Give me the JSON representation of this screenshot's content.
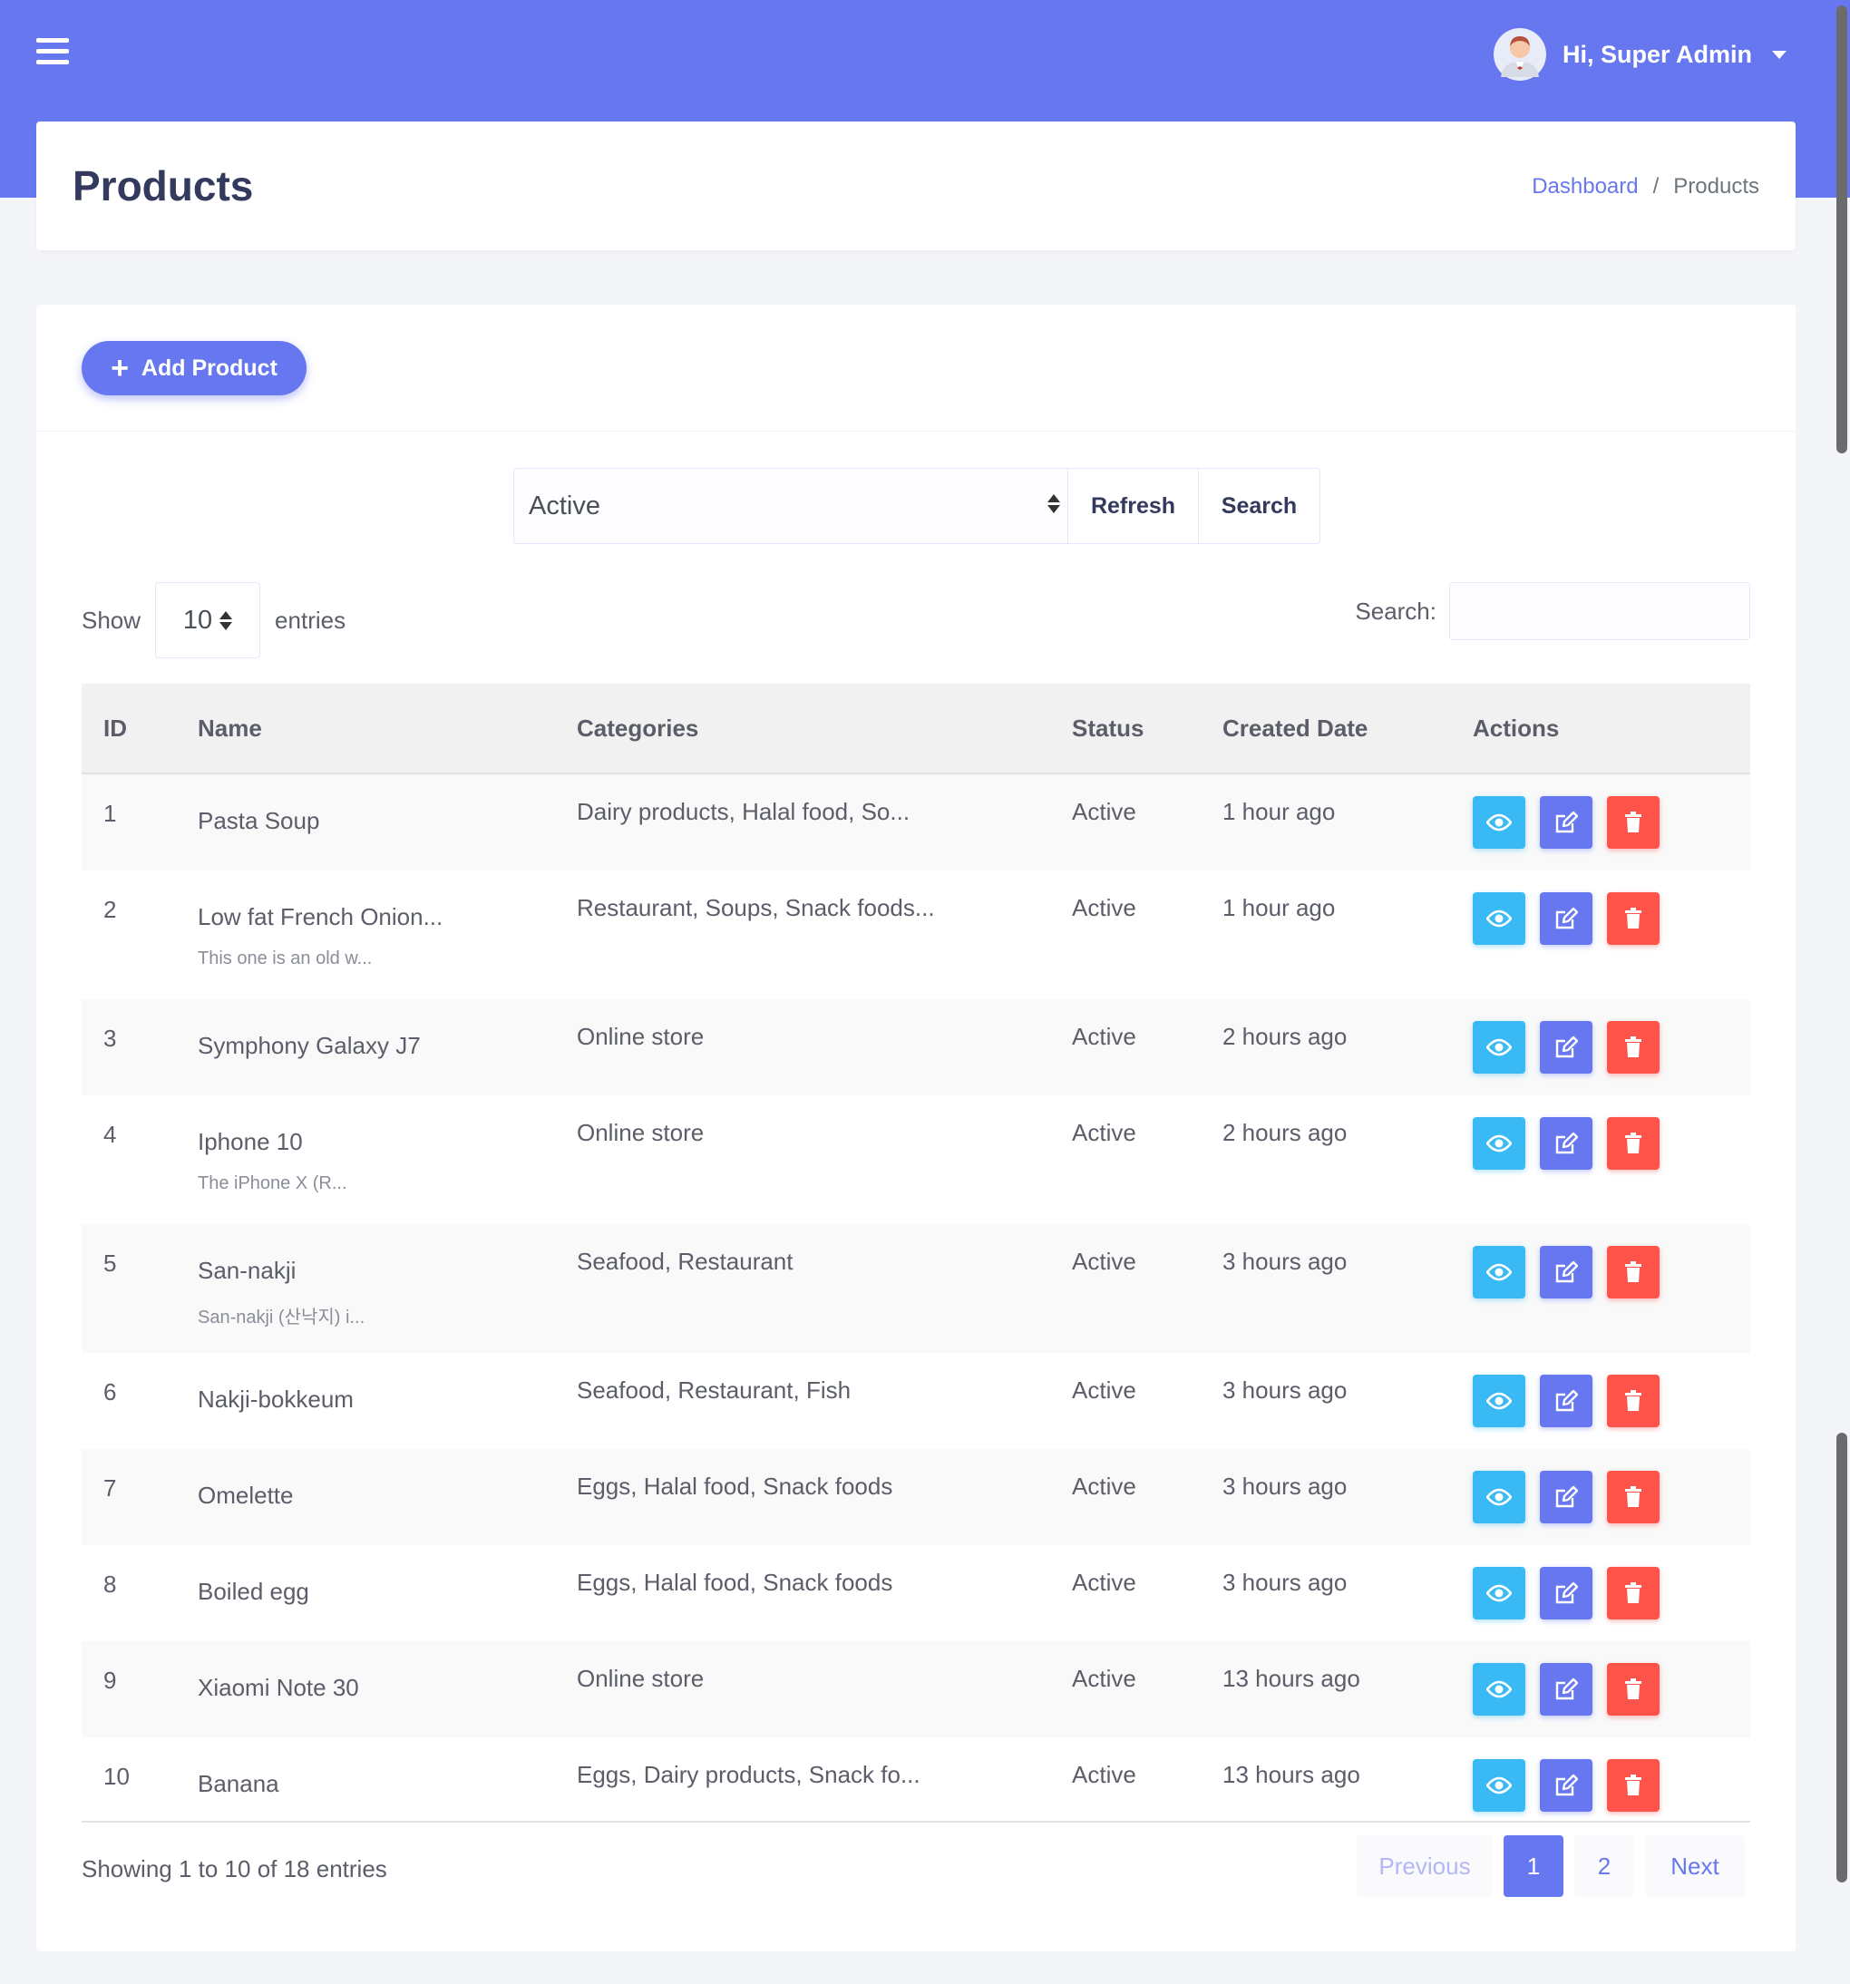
{
  "header": {
    "user_greeting": "Hi, Super Admin"
  },
  "page": {
    "title": "Products",
    "breadcrumb": {
      "dashboard": "Dashboard",
      "separator": "/",
      "current": "Products"
    }
  },
  "toolbar": {
    "add_label": "Add Product"
  },
  "filter": {
    "status_value": "Active",
    "refresh_label": "Refresh",
    "search_label": "Search"
  },
  "table_controls": {
    "show_label": "Show",
    "page_length": "10",
    "entries_label": "entries",
    "search_label": "Search:"
  },
  "table": {
    "columns": {
      "id": "ID",
      "name": "Name",
      "categories": "Categories",
      "status": "Status",
      "created": "Created Date",
      "actions": "Actions"
    },
    "rows": [
      {
        "id": "1",
        "name": "Pasta Soup",
        "desc": "",
        "categories": "Dairy products, Halal food, So...",
        "status": "Active",
        "created": "1 hour ago"
      },
      {
        "id": "2",
        "name": "Low fat French Onion...",
        "desc": "This one is an old w...",
        "categories": "Restaurant, Soups, Snack foods...",
        "status": "Active",
        "created": "1 hour ago"
      },
      {
        "id": "3",
        "name": "Symphony Galaxy J7",
        "desc": "",
        "categories": "Online store",
        "status": "Active",
        "created": "2 hours ago"
      },
      {
        "id": "4",
        "name": "Iphone 10",
        "desc": "The iPhone X (R...",
        "categories": "Online store",
        "status": "Active",
        "created": "2 hours ago"
      },
      {
        "id": "5",
        "name": "San-nakji",
        "desc": "San-nakji (산낙지) i...",
        "categories": "Seafood, Restaurant",
        "status": "Active",
        "created": "3 hours ago"
      },
      {
        "id": "6",
        "name": "Nakji-bokkeum",
        "desc": "",
        "categories": "Seafood, Restaurant, Fish",
        "status": "Active",
        "created": "3 hours ago"
      },
      {
        "id": "7",
        "name": "Omelette",
        "desc": "",
        "categories": "Eggs, Halal food, Snack foods",
        "status": "Active",
        "created": "3 hours ago"
      },
      {
        "id": "8",
        "name": "Boiled egg",
        "desc": "",
        "categories": "Eggs, Halal food, Snack foods",
        "status": "Active",
        "created": "3 hours ago"
      },
      {
        "id": "9",
        "name": "Xiaomi Note 30",
        "desc": "",
        "categories": "Online store",
        "status": "Active",
        "created": "13 hours ago"
      },
      {
        "id": "10",
        "name": "Banana",
        "desc": "",
        "categories": "Eggs, Dairy products, Snack fo...",
        "status": "Active",
        "created": "13 hours ago"
      }
    ]
  },
  "footer": {
    "info": "Showing 1 to 10 of 18 entries",
    "previous": "Previous",
    "pages": [
      "1",
      "2"
    ],
    "next": "Next"
  },
  "colors": {
    "primary": "#6777ef",
    "info": "#3abaf4",
    "danger": "#fc544b"
  },
  "icons": [
    "menu-icon",
    "user-avatar-icon",
    "caret-down-icon",
    "plus-icon",
    "sort-arrows-icon",
    "eye-icon",
    "edit-icon",
    "trash-icon"
  ]
}
